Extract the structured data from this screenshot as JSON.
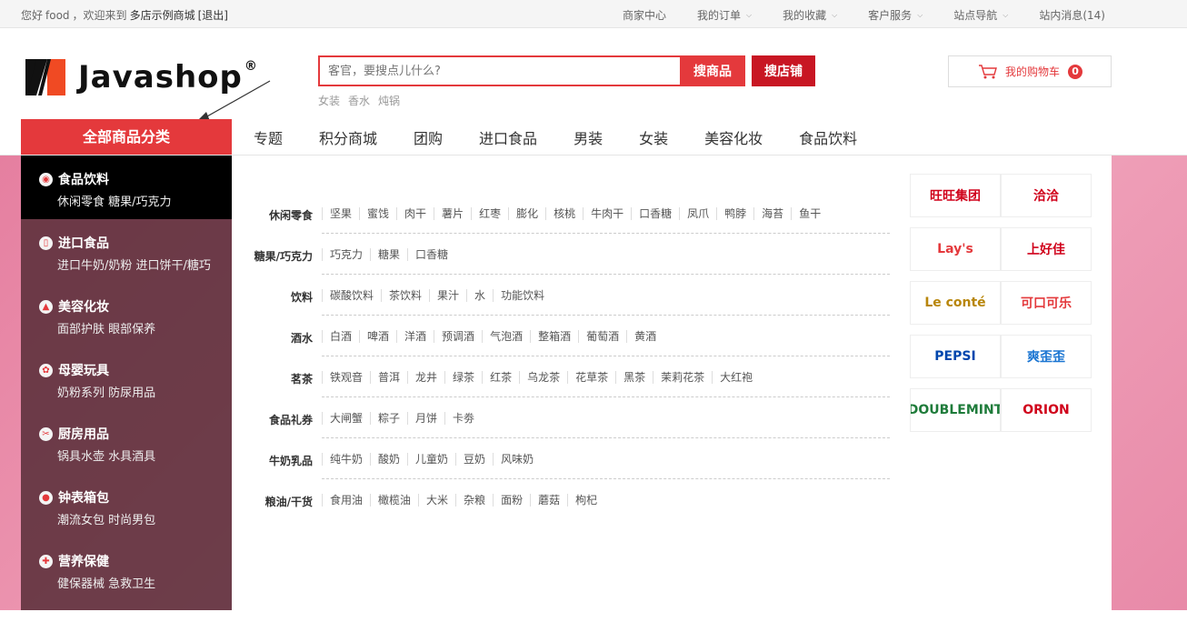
{
  "topbar": {
    "greeting_prefix": "您好",
    "username": "food",
    "welcome": "，欢迎来到",
    "shop_name": "多店示例商城",
    "logout": "[退出]",
    "links": [
      {
        "label": "商家中心",
        "dropdown": false
      },
      {
        "label": "我的订单",
        "dropdown": true
      },
      {
        "label": "我的收藏",
        "dropdown": true
      },
      {
        "label": "客户服务",
        "dropdown": true
      },
      {
        "label": "站点导航",
        "dropdown": true
      },
      {
        "label": "站内消息(14)",
        "dropdown": false
      }
    ]
  },
  "logo": {
    "text": "Javashop",
    "reg": "®"
  },
  "search": {
    "placeholder": "客官，要搜点儿什么?",
    "goods_button": "搜商品",
    "shop_button": "搜店铺",
    "hotwords": [
      "女装",
      "香水",
      "炖锅"
    ]
  },
  "cart": {
    "label": "我的购物车",
    "count": "0"
  },
  "nav": {
    "all_categories": "全部商品分类",
    "items": [
      "专题",
      "积分商城",
      "团购",
      "进口食品",
      "男装",
      "女装",
      "美容化妆",
      "食品饮料"
    ]
  },
  "categories": [
    {
      "title": "食品饮料",
      "sub": "休闲零食 糖果/巧克力",
      "icon": "food-icon"
    },
    {
      "title": "进口食品",
      "sub": "进口牛奶/奶粉 进口饼干/糖巧",
      "icon": "bottle-icon"
    },
    {
      "title": "美容化妆",
      "sub": "面部护肤 眼部保养",
      "icon": "cosmetic-icon"
    },
    {
      "title": "母婴玩具",
      "sub": "奶粉系列 防尿用品",
      "icon": "baby-icon"
    },
    {
      "title": "厨房用品",
      "sub": "锅具水壶 水具酒具",
      "icon": "kitchen-icon"
    },
    {
      "title": "钟表箱包",
      "sub": "潮流女包 时尚男包",
      "icon": "bag-icon"
    },
    {
      "title": "营养保健",
      "sub": "健保器械 急救卫生",
      "icon": "pill-icon"
    }
  ],
  "subcategories": [
    {
      "title": "休闲零食",
      "items": [
        "坚果",
        "蜜饯",
        "肉干",
        "薯片",
        "红枣",
        "膨化",
        "核桃",
        "牛肉干",
        "口香糖",
        "凤爪",
        "鸭脖",
        "海苔",
        "鱼干"
      ]
    },
    {
      "title": "糖果/巧克力",
      "items": [
        "巧克力",
        "糖果",
        "口香糖"
      ]
    },
    {
      "title": "饮料",
      "items": [
        "碳酸饮料",
        "茶饮料",
        "果汁",
        "水",
        "功能饮料"
      ]
    },
    {
      "title": "酒水",
      "items": [
        "白酒",
        "啤酒",
        "洋酒",
        "预调酒",
        "气泡酒",
        "整箱酒",
        "葡萄酒",
        "黄酒"
      ]
    },
    {
      "title": "茗茶",
      "items": [
        "铁观音",
        "普洱",
        "龙井",
        "绿茶",
        "红茶",
        "乌龙茶",
        "花草茶",
        "黑茶",
        "茉莉花茶",
        "大红袍"
      ]
    },
    {
      "title": "食品礼券",
      "items": [
        "大闸蟹",
        "粽子",
        "月饼",
        "卡劵"
      ]
    },
    {
      "title": "牛奶乳品",
      "items": [
        "纯牛奶",
        "酸奶",
        "儿童奶",
        "豆奶",
        "风味奶"
      ]
    },
    {
      "title": "粮油/干货",
      "items": [
        "食用油",
        "橄榄油",
        "大米",
        "杂粮",
        "面粉",
        "蘑菇",
        "枸杞"
      ]
    }
  ],
  "brands": [
    {
      "name": "旺旺集团",
      "color": "#d0021b"
    },
    {
      "name": "洽洽",
      "color": "#d0021b"
    },
    {
      "name": "Lay's",
      "color": "#e4393c"
    },
    {
      "name": "上好佳",
      "color": "#d0021b"
    },
    {
      "name": "Le conté",
      "color": "#b8860b"
    },
    {
      "name": "可口可乐",
      "color": "#e4393c"
    },
    {
      "name": "PEPSI",
      "color": "#0046ad"
    },
    {
      "name": "爽歪歪",
      "color": "#1a75d2"
    },
    {
      "name": "DOUBLEMINT",
      "color": "#1e7b3a"
    },
    {
      "name": "ORION",
      "color": "#d0021b"
    }
  ],
  "colors": {
    "accent": "#e4393c",
    "shop_button": "#c81623",
    "banner": "#ee9bb4"
  }
}
